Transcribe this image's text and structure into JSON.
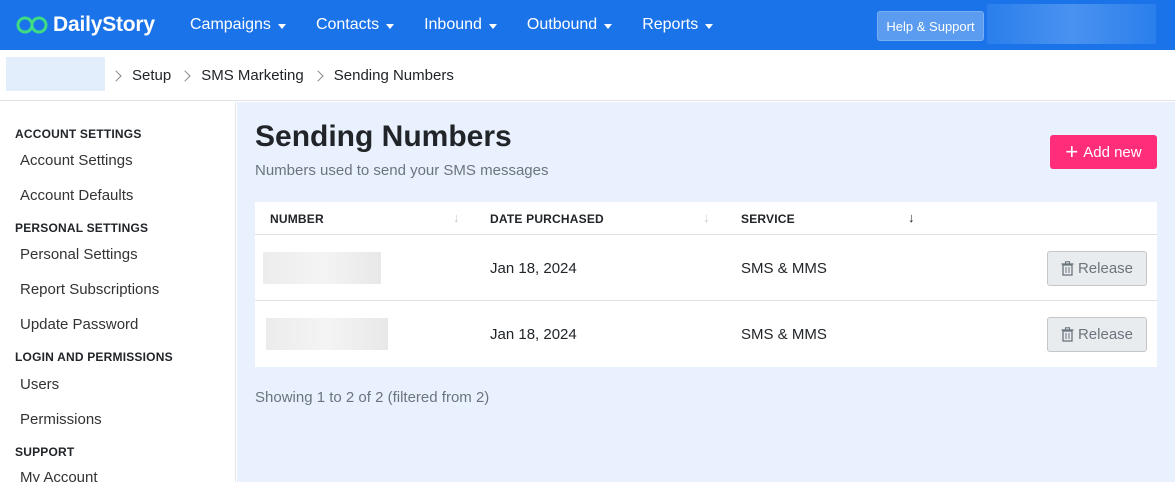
{
  "brand": {
    "name": "DailyStory"
  },
  "nav": {
    "items": [
      {
        "label": "Campaigns"
      },
      {
        "label": "Contacts"
      },
      {
        "label": "Inbound"
      },
      {
        "label": "Outbound"
      },
      {
        "label": "Reports"
      }
    ],
    "help_label": "Help & Support"
  },
  "breadcrumb": {
    "items": [
      "Setup",
      "SMS Marketing",
      "Sending Numbers"
    ]
  },
  "sidebar": {
    "sections": [
      {
        "header": "ACCOUNT SETTINGS",
        "items": [
          "Account Settings",
          "Account Defaults"
        ]
      },
      {
        "header": "PERSONAL SETTINGS",
        "items": [
          "Personal Settings",
          "Report Subscriptions",
          "Update Password"
        ]
      },
      {
        "header": "LOGIN AND PERMISSIONS",
        "items": [
          "Users",
          "Permissions"
        ]
      },
      {
        "header": "SUPPORT",
        "items": [
          "My Account"
        ]
      }
    ]
  },
  "main": {
    "title": "Sending Numbers",
    "subtitle": "Numbers used to send your SMS messages",
    "add_label": "Add new",
    "table": {
      "columns": [
        "NUMBER",
        "DATE PURCHASED",
        "SERVICE"
      ],
      "rows": [
        {
          "date": "Jan 18, 2024",
          "service": "SMS & MMS",
          "action": "Release"
        },
        {
          "date": "Jan 18, 2024",
          "service": "SMS & MMS",
          "action": "Release"
        }
      ]
    },
    "showing": "Showing 1 to 2 of 2 (filtered from 2)"
  },
  "colors": {
    "nav_bg": "#1a73e8",
    "accent_pink": "#ff2d7a",
    "main_bg": "#e8f1fd"
  }
}
